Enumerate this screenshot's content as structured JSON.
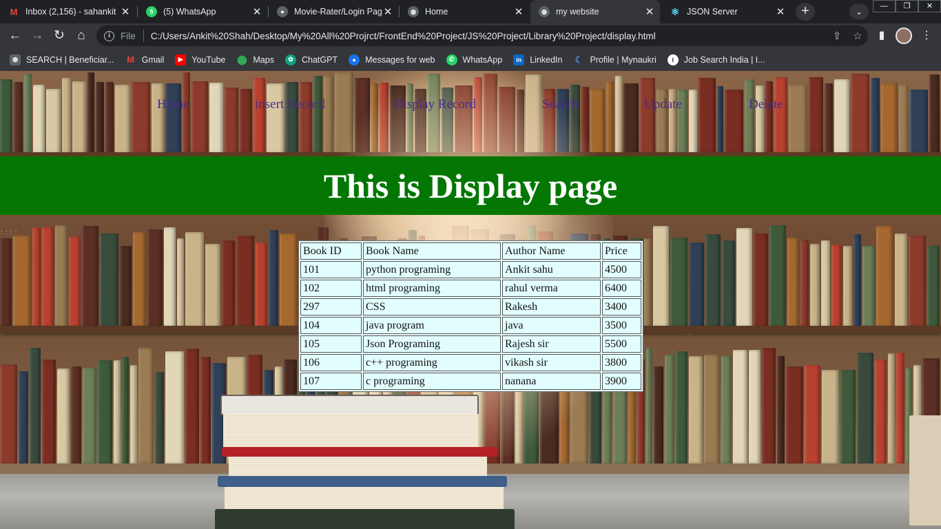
{
  "browser": {
    "tabs": [
      {
        "title": "Inbox (2,156) - sahankit",
        "icon": "gmail-icon",
        "color": "#ea4335",
        "active": false
      },
      {
        "title": "(5) WhatsApp",
        "icon": "whatsapp-icon",
        "color": "#25d366",
        "active": false
      },
      {
        "title": "Movie-Rater/Login Page",
        "icon": "github-icon",
        "color": "#5f6368",
        "active": false
      },
      {
        "title": "Home",
        "icon": "globe-icon",
        "color": "#5f6368",
        "active": false
      },
      {
        "title": "my website",
        "icon": "globe-icon",
        "color": "#5f6368",
        "active": true
      },
      {
        "title": "JSON Server",
        "icon": "react-icon",
        "color": "#61dafb",
        "active": false
      }
    ],
    "address": {
      "scheme": "File",
      "url": "C:/Users/Ankit%20Shah/Desktop/My%20All%20Projrct/FrontEnd%20Project/JS%20Project/Library%20Project/display.html"
    },
    "bookmarks": [
      {
        "label": "SEARCH | Beneficiar...",
        "icon": "globe-icon",
        "color": "#5f6368"
      },
      {
        "label": "Gmail",
        "icon": "gmail-icon",
        "color": "#ea4335"
      },
      {
        "label": "YouTube",
        "icon": "youtube-icon",
        "color": "#ff0000"
      },
      {
        "label": "Maps",
        "icon": "maps-icon",
        "color": "#34a853"
      },
      {
        "label": "ChatGPT",
        "icon": "chatgpt-icon",
        "color": "#10a37f"
      },
      {
        "label": "Messages for web",
        "icon": "messages-icon",
        "color": "#1a73e8"
      },
      {
        "label": "WhatsApp",
        "icon": "whatsapp-icon",
        "color": "#25d366"
      },
      {
        "label": "LinkedIn",
        "icon": "linkedin-icon",
        "color": "#0a66c2"
      },
      {
        "label": "Profile | Mynaukri",
        "icon": "naukri-icon",
        "color": "#4a90e2"
      },
      {
        "label": "Job Search India | I...",
        "icon": "info-icon",
        "color": "#ffffff"
      }
    ]
  },
  "site": {
    "nav": [
      "Home",
      "insert Record",
      "Display Record",
      "Search",
      "Update",
      "Delete"
    ],
    "banner_title": "This is Display page",
    "dots": ": : : :",
    "table": {
      "headers": [
        "Book ID",
        "Book Name",
        "Author Name",
        "Price"
      ],
      "rows": [
        [
          "101",
          "python programing",
          "Ankit sahu",
          "4500"
        ],
        [
          "102",
          "html programing",
          "rahul verma",
          "6400"
        ],
        [
          "297",
          "CSS",
          "Rakesh",
          "3400"
        ],
        [
          "104",
          "java program",
          "java",
          "3500"
        ],
        [
          "105",
          "Json Programing",
          "Rajesh sir",
          "5500"
        ],
        [
          "106",
          "c++ programing",
          "vikash sir",
          "3800"
        ],
        [
          "107",
          "c programing",
          "nanana",
          "3900"
        ]
      ]
    },
    "colors": {
      "banner": "#037603",
      "nav_link": "#4b2a86",
      "table_cell": "#e2fdfd"
    }
  }
}
